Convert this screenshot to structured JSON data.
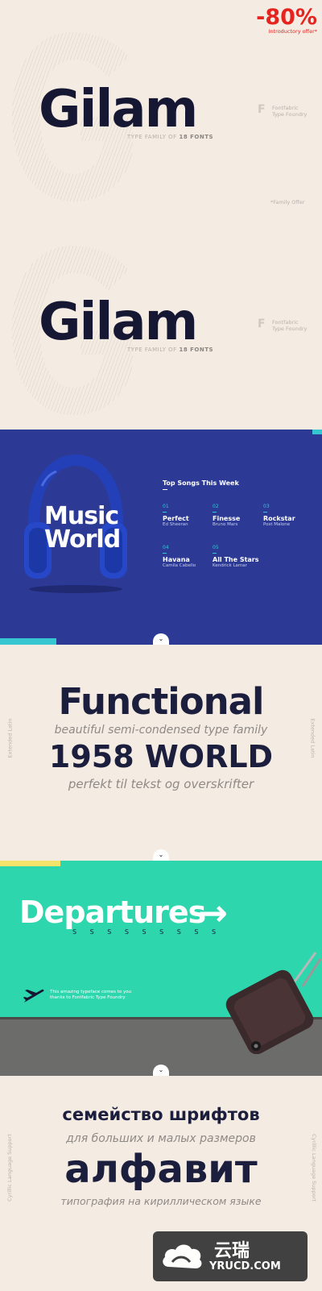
{
  "promo": {
    "discount": "-80%",
    "note": "Introductory offer*",
    "family_offer": "*Family Offer"
  },
  "gilam": {
    "title": "Gilam",
    "subtitle_prefix": "TYPE FAMILY OF",
    "subtitle_count": "18 FONTS",
    "foundry_line1": "Fontfabric",
    "foundry_line2": "Type Foundry",
    "foundry_logo": "F"
  },
  "music": {
    "title_line1": "Music",
    "title_line2": "World",
    "songs_heading": "Top Songs This Week",
    "songs": [
      {
        "num": "01",
        "title": "Perfect",
        "artist": "Ed Sheeran"
      },
      {
        "num": "02",
        "title": "Finesse",
        "artist": "Bruno Mars"
      },
      {
        "num": "03",
        "title": "Rockstar",
        "artist": "Post Malone"
      },
      {
        "num": "04",
        "title": "Havana",
        "artist": "Camila Cabello"
      },
      {
        "num": "05",
        "title": "All The Stars",
        "artist": "Kendrick Lamar"
      }
    ],
    "accent_colors": {
      "background": "#2c3a96",
      "cyan": "#36c6d1"
    }
  },
  "functional": {
    "title": "Functional",
    "subtitle": "beautiful semi-condensed type family",
    "big": "1958 WORLD",
    "tagline": "perfekt til tekst og overskrifter",
    "side_label": "Extended Latin"
  },
  "departures": {
    "title": "Departures",
    "arrow": "→",
    "s_row": "S S S S S S S S S",
    "note_line1": "This amazing typeface comes to you",
    "note_line2": "thanks to Fontfabric Type Foundry",
    "plane_icon": "airplane-icon",
    "accent_colors": {
      "background": "#2ed6ae",
      "yellow": "#f5e36a"
    }
  },
  "cyrillic": {
    "title": "семейство шрифтов",
    "subtitle": "для больших и малых размеров",
    "big": "алфавит",
    "tagline": "типография на кириллическом языке",
    "side_label": "Cyrillic Language Support"
  },
  "watermark": {
    "name": "云瑞",
    "url": "YRUCD.COM"
  },
  "nav": {
    "chevron": "⌄"
  }
}
